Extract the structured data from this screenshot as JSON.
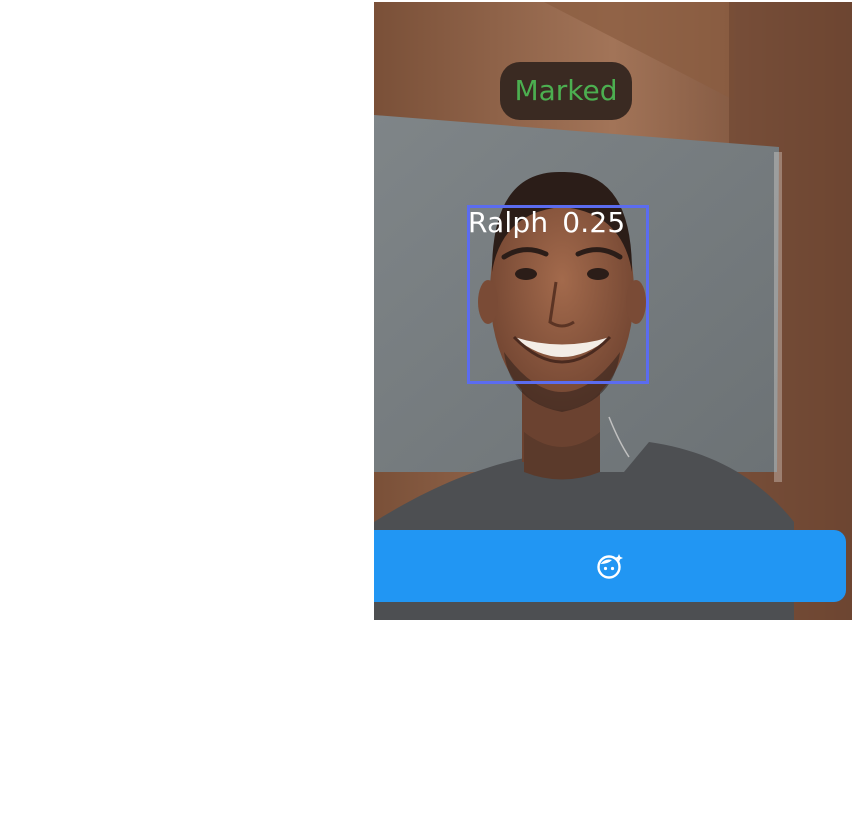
{
  "camera": {
    "status_text": "Marked",
    "detected_face": {
      "name": "Ralph",
      "score": "0.25"
    }
  },
  "action_button": {
    "icon": "face-retouching-icon"
  },
  "colors": {
    "status_text": "#4caf50",
    "face_box": "#5b6cf0",
    "button": "#2196f3"
  }
}
